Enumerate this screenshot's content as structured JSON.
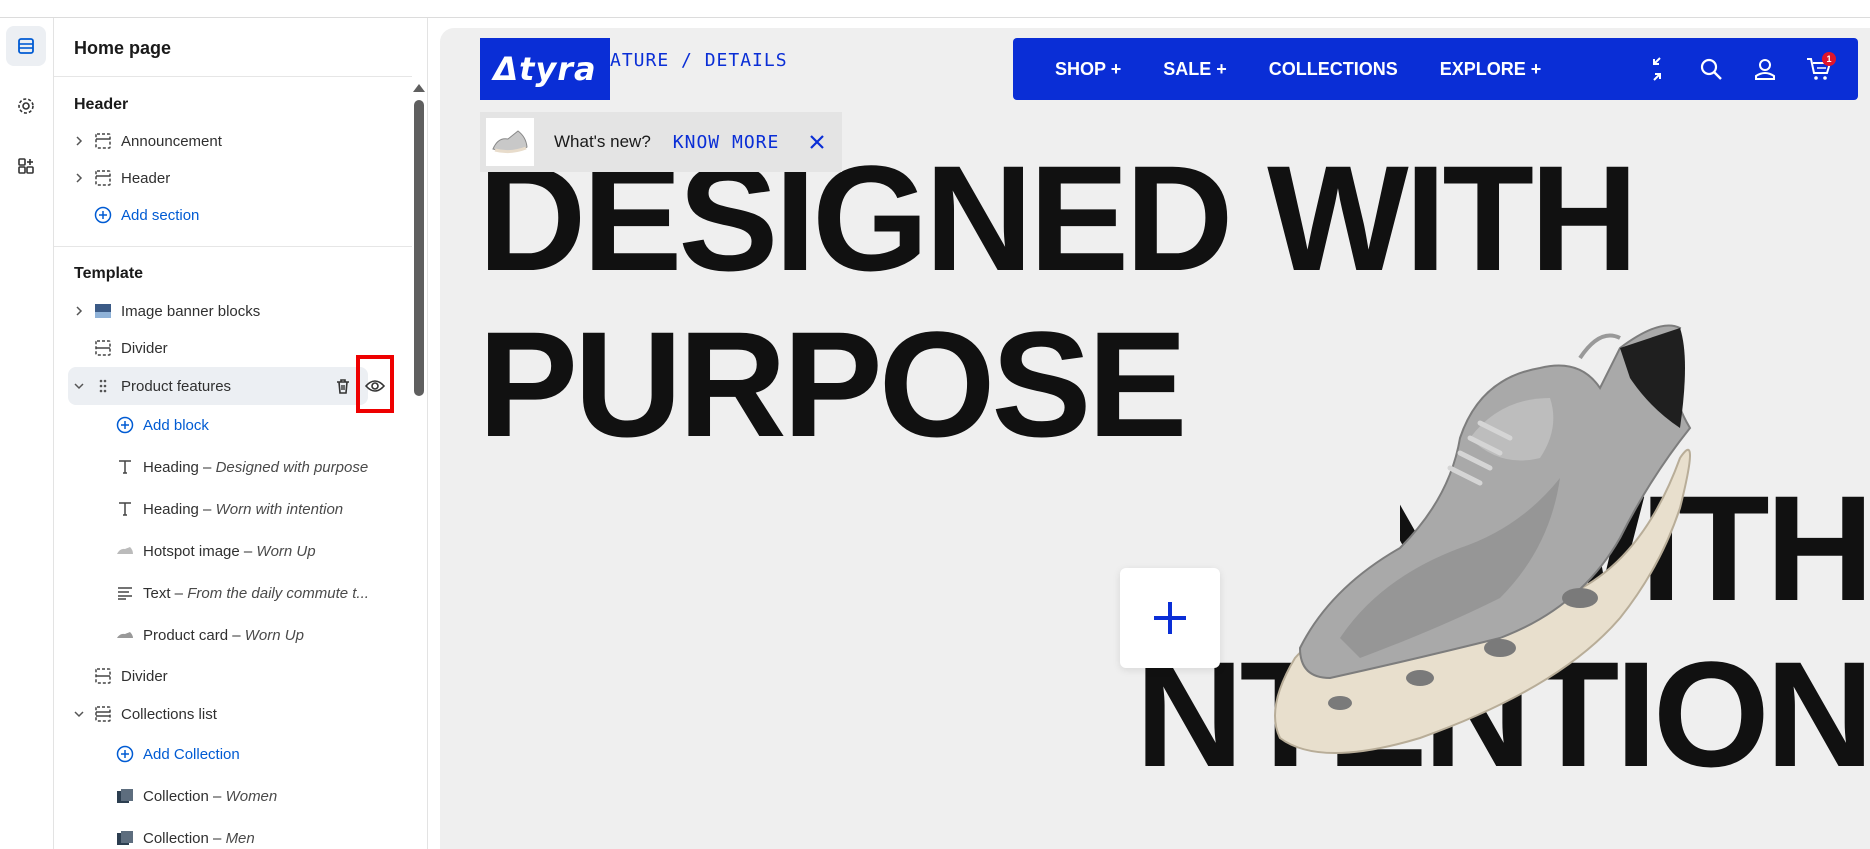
{
  "editor": {
    "panel_title": "Home page",
    "header_group": {
      "title": "Header",
      "items": [
        {
          "label": "Announcement"
        },
        {
          "label": "Header"
        }
      ],
      "add_label": "Add section"
    },
    "template_group": {
      "title": "Template",
      "items": [
        {
          "label": "Image banner blocks"
        },
        {
          "label": "Divider"
        },
        {
          "label": "Product features"
        }
      ],
      "add_block_label": "Add block",
      "blocks": [
        {
          "kind": "Heading",
          "sub": "Designed with purpose"
        },
        {
          "kind": "Heading",
          "sub": "Worn with intention"
        },
        {
          "kind": "Hotspot image",
          "sub": "Worn Up"
        },
        {
          "kind": "Text",
          "sub": "From the daily commute t..."
        },
        {
          "kind": "Product card",
          "sub": "Worn Up"
        }
      ],
      "divider2": "Divider",
      "collections": "Collections list",
      "add_collection_label": "Add Collection",
      "collection_items": [
        {
          "kind": "Collection",
          "sub": "Women"
        },
        {
          "kind": "Collection",
          "sub": "Men"
        }
      ],
      "separator": " – "
    }
  },
  "preview": {
    "logo": "Δtyra",
    "breadcrumb": "ATURE / DETAILS",
    "nav": [
      {
        "label": "SHOP +"
      },
      {
        "label": "SALE +"
      },
      {
        "label": "COLLECTIONS"
      },
      {
        "label": "EXPLORE +"
      }
    ],
    "cart_count": "1",
    "news": {
      "text": "What's new?",
      "link": "KNOW MORE"
    },
    "hero_line1": "DESIGNED WITH",
    "hero_line2": "PURPOSE",
    "hero_line3": "N WITH",
    "hero_line4": "INTENTION",
    "hotspot_symbol": "+"
  },
  "colors": {
    "brand_blue": "#0a2ed6",
    "highlight_red": "#e00000",
    "link_blue": "#005bd3"
  }
}
